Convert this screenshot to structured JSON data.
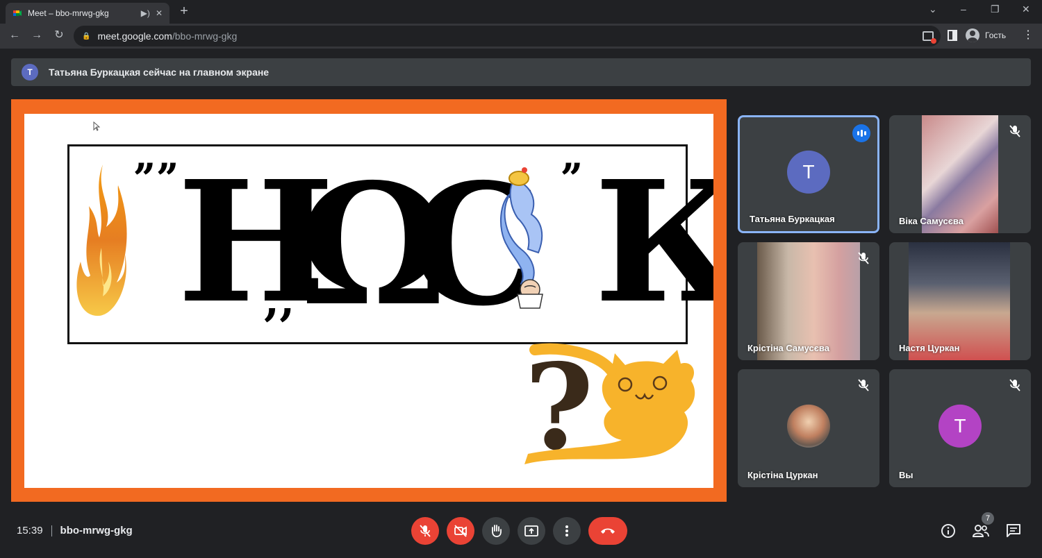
{
  "browser": {
    "tab_title": "Meet – bbo-mrwg-gkg",
    "url_host": "meet.google.com",
    "url_path": "/bbo-mrwg-gkg",
    "profile_label": "Гость"
  },
  "notification": {
    "avatar_letter": "T",
    "text": "Татьяна Буркацкая сейчас на главном экране"
  },
  "slide": {
    "leading_marks": "ˮˮ",
    "glyph_1": "Н",
    "mid_marks": ",,",
    "glyph_2": "Ω",
    "glyph_3": "С",
    "glyph_4": "К",
    "trailing_marks": "ˮ",
    "question_mark": "?"
  },
  "participants": [
    {
      "name": "Татьяна Буркацкая",
      "avatar_letter": "T",
      "avatar_color": "#5c6bc0",
      "speaking": true
    },
    {
      "name": "Віка Самусєва",
      "video": true,
      "muted": true
    },
    {
      "name": "Крістіна Самусєва",
      "video": true,
      "muted": true
    },
    {
      "name": "Настя Цуркан",
      "video": true,
      "muted": false
    },
    {
      "name": "Крістіна Цуркан",
      "photo": true,
      "muted": true
    },
    {
      "name": "Вы",
      "avatar_letter": "T",
      "avatar_color": "#b343c4",
      "muted": true
    }
  ],
  "meeting": {
    "time": "15:39",
    "code": "bbo-mrwg-gkg",
    "participant_count": "7"
  },
  "colors": {
    "presentation_border": "#f26a21",
    "end_call": "#ea4335",
    "active_speaker": "#8ab4f8"
  }
}
